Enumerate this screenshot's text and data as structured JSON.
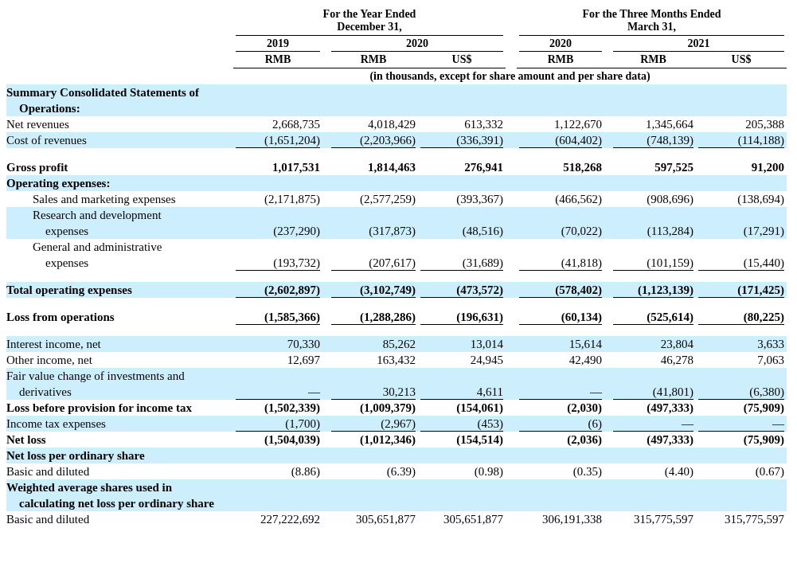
{
  "column_groups": [
    {
      "title": "For the Year Ended December 31,",
      "years": [
        {
          "year": "2019",
          "currencies": [
            "RMB"
          ]
        },
        {
          "year": "2020",
          "currencies": [
            "RMB",
            "US$"
          ]
        }
      ]
    },
    {
      "title": "For the Three Months Ended March 31,",
      "years": [
        {
          "year": "2020",
          "currencies": [
            "RMB"
          ]
        },
        {
          "year": "2021",
          "currencies": [
            "RMB",
            "US$"
          ]
        }
      ]
    }
  ],
  "unit_note": "(in thousands, except for share amount and per share data)",
  "rows": [
    {
      "kind": "section",
      "label": "Summary Consolidated Statements of Operations:",
      "shaded": true,
      "space_before": false,
      "rule_below": false,
      "values": []
    },
    {
      "kind": "item",
      "label": "Net revenues",
      "shaded": false,
      "space_before": false,
      "rule_below": false,
      "values": [
        "2,668,735",
        "4,018,429",
        "613,332",
        "1,122,670",
        "1,345,664",
        "205,388"
      ]
    },
    {
      "kind": "item",
      "label": "Cost of revenues",
      "shaded": true,
      "space_before": false,
      "rule_below": true,
      "values": [
        "(1,651,204)",
        "(2,203,966)",
        "(336,391)",
        "(604,402)",
        "(748,139)",
        "(114,188)"
      ]
    },
    {
      "kind": "total",
      "label": "Gross profit",
      "shaded": false,
      "space_before": true,
      "rule_below": false,
      "values": [
        "1,017,531",
        "1,814,463",
        "276,941",
        "518,268",
        "597,525",
        "91,200"
      ]
    },
    {
      "kind": "section",
      "label": "Operating expenses:",
      "shaded": true,
      "space_before": false,
      "rule_below": false,
      "values": []
    },
    {
      "kind": "subitem",
      "label": "Sales and marketing expenses",
      "shaded": false,
      "space_before": false,
      "rule_below": false,
      "values": [
        "(2,171,875)",
        "(2,577,259)",
        "(393,367)",
        "(466,562)",
        "(908,696)",
        "(138,694)"
      ]
    },
    {
      "kind": "subitem",
      "label": "Research and development expenses",
      "shaded": true,
      "space_before": false,
      "rule_below": false,
      "values": [
        "(237,290)",
        "(317,873)",
        "(48,516)",
        "(70,022)",
        "(113,284)",
        "(17,291)"
      ]
    },
    {
      "kind": "subitem",
      "label": "General and administrative expenses",
      "shaded": false,
      "space_before": false,
      "rule_below": true,
      "values": [
        "(193,732)",
        "(207,617)",
        "(31,689)",
        "(41,818)",
        "(101,159)",
        "(15,440)"
      ]
    },
    {
      "kind": "total",
      "label": "Total operating expenses",
      "shaded": true,
      "space_before": true,
      "rule_below": true,
      "values": [
        "(2,602,897)",
        "(3,102,749)",
        "(473,572)",
        "(578,402)",
        "(1,123,139)",
        "(171,425)"
      ]
    },
    {
      "kind": "total",
      "label": "Loss from operations",
      "shaded": false,
      "space_before": true,
      "rule_below": true,
      "values": [
        "(1,585,366)",
        "(1,288,286)",
        "(196,631)",
        "(60,134)",
        "(525,614)",
        "(80,225)"
      ]
    },
    {
      "kind": "item",
      "label": "Interest income, net",
      "shaded": true,
      "space_before": true,
      "rule_below": false,
      "values": [
        "70,330",
        "85,262",
        "13,014",
        "15,614",
        "23,804",
        "3,633"
      ]
    },
    {
      "kind": "item",
      "label": "Other income, net",
      "shaded": false,
      "space_before": false,
      "rule_below": false,
      "values": [
        "12,697",
        "163,432",
        "24,945",
        "42,490",
        "46,278",
        "7,063"
      ]
    },
    {
      "kind": "item",
      "label": "Fair value change of investments and derivatives",
      "shaded": true,
      "space_before": false,
      "rule_below": true,
      "values": [
        "—",
        "30,213",
        "4,611",
        "—",
        "(41,801)",
        "(6,380)"
      ]
    },
    {
      "kind": "total",
      "label": "Loss before provision for income tax",
      "shaded": false,
      "space_before": false,
      "rule_below": false,
      "values": [
        "(1,502,339)",
        "(1,009,379)",
        "(154,061)",
        "(2,030)",
        "(497,333)",
        "(75,909)"
      ]
    },
    {
      "kind": "item",
      "label": "Income tax expenses",
      "shaded": true,
      "space_before": false,
      "rule_below": true,
      "values": [
        "(1,700)",
        "(2,967)",
        "(453)",
        "(6)",
        "—",
        "—"
      ]
    },
    {
      "kind": "total",
      "label": "Net loss",
      "shaded": false,
      "space_before": false,
      "rule_below": false,
      "values": [
        "(1,504,039)",
        "(1,012,346)",
        "(154,514)",
        "(2,036)",
        "(497,333)",
        "(75,909)"
      ]
    },
    {
      "kind": "section",
      "label": "Net loss per ordinary share",
      "shaded": true,
      "space_before": false,
      "rule_below": false,
      "values": []
    },
    {
      "kind": "item",
      "label": "Basic and diluted",
      "shaded": false,
      "space_before": false,
      "rule_below": false,
      "values": [
        "(8.86)",
        "(6.39)",
        "(0.98)",
        "(0.35)",
        "(4.40)",
        "(0.67)"
      ]
    },
    {
      "kind": "section",
      "label": "Weighted average shares used in calculating net loss per ordinary share",
      "shaded": true,
      "space_before": false,
      "rule_below": false,
      "values": []
    },
    {
      "kind": "item",
      "label": "Basic and diluted",
      "shaded": false,
      "space_before": false,
      "rule_below": false,
      "values": [
        "227,222,692",
        "305,651,877",
        "305,651,877",
        "306,191,338",
        "315,775,597",
        "315,775,597"
      ]
    }
  ]
}
